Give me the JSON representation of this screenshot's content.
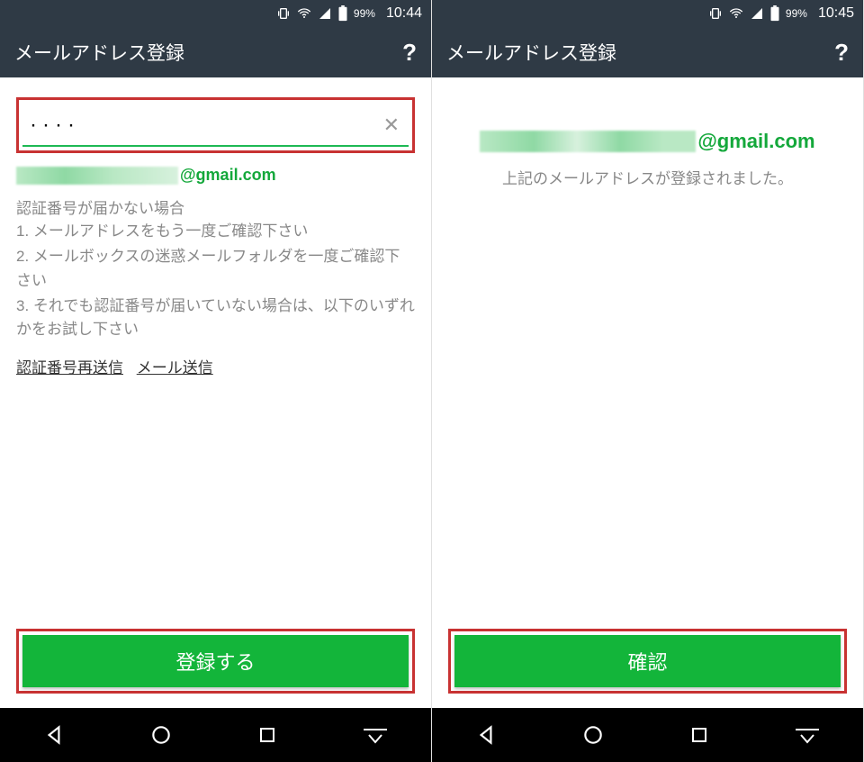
{
  "colors": {
    "accent_green": "#13b53a",
    "header_bg": "#2f3a45",
    "highlight_red": "#c83232",
    "muted_text": "#888888"
  },
  "left": {
    "status": {
      "battery_pct": "99%",
      "time": "10:44"
    },
    "header": {
      "title": "メールアドレス登録",
      "help_icon": "?"
    },
    "input": {
      "value_masked": "····",
      "clear_icon": "✕"
    },
    "email_domain": "@gmail.com",
    "help_heading": "認証番号が届かない場合",
    "help_items": [
      "1. メールアドレスをもう一度ご確認下さい",
      "2. メールボックスの迷惑メールフォルダを一度ご確認下さい",
      "3. それでも認証番号が届いていない場合は、以下のいずれかをお試し下さい"
    ],
    "links": {
      "resend": "認証番号再送信",
      "send_mail": "メール送信"
    },
    "primary_button": "登録する"
  },
  "right": {
    "status": {
      "battery_pct": "99%",
      "time": "10:45"
    },
    "header": {
      "title": "メールアドレス登録",
      "help_icon": "?"
    },
    "email_domain": "@gmail.com",
    "confirm_message": "上記のメールアドレスが登録されました。",
    "primary_button": "確認"
  },
  "nav": {
    "back_icon": "back-triangle",
    "home_icon": "home-circle",
    "recent_icon": "recent-square",
    "ime_icon": "ime-toggle"
  }
}
